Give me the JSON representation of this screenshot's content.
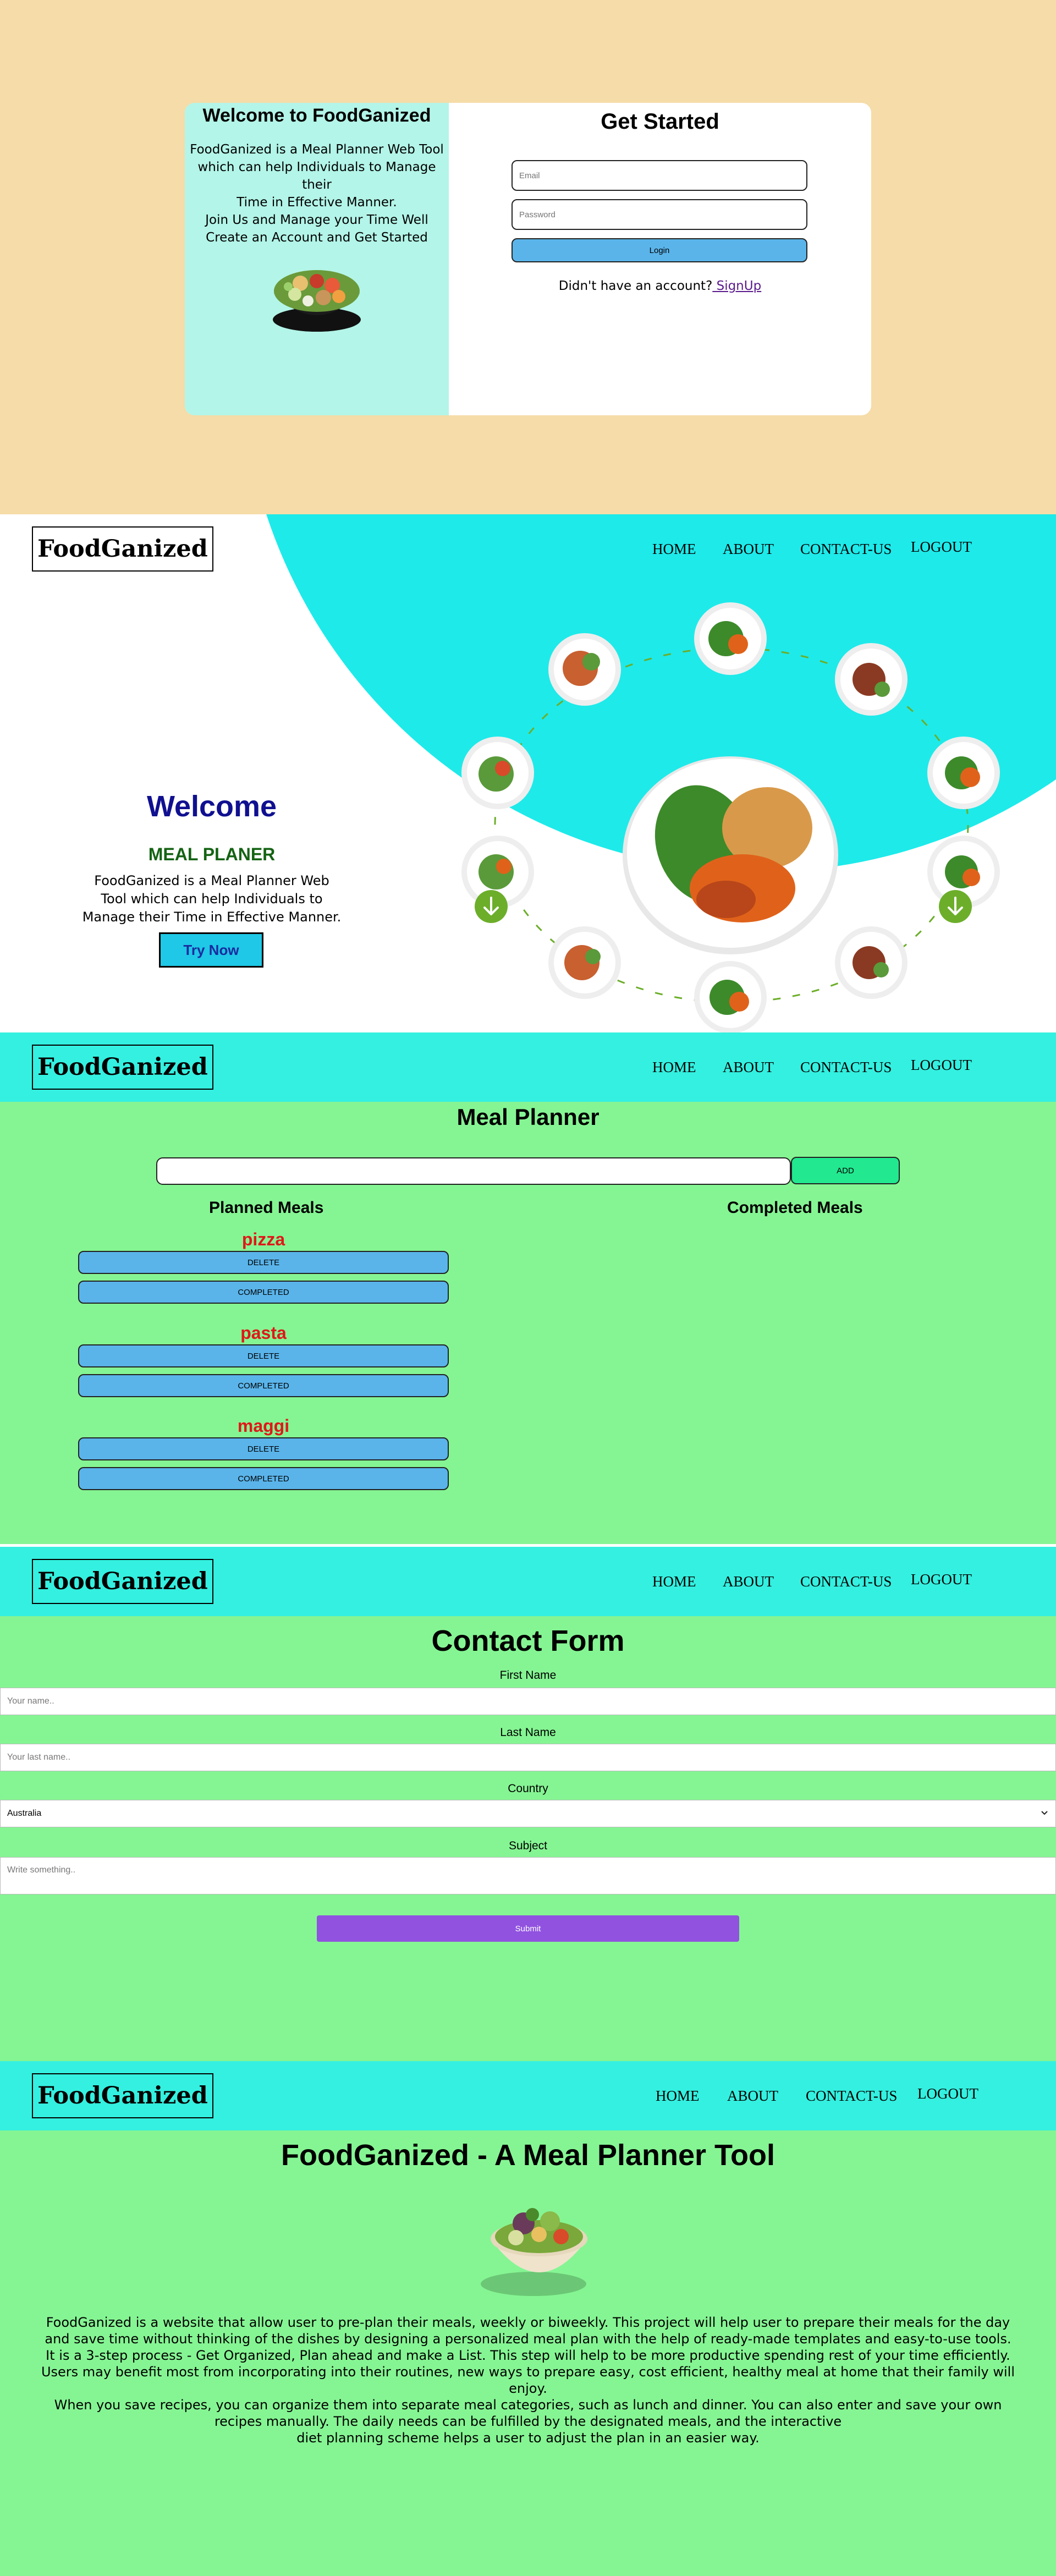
{
  "login": {
    "welcome_title": "Welcome to FoodGanized",
    "intro_lines": [
      "FoodGanized is a Meal Planner Web Tool",
      "which can help Individuals to Manage their",
      "Time in Effective Manner.",
      "Join Us and Manage your Time Well",
      "Create an Account and Get Started"
    ],
    "form_title": "Get Started",
    "email_placeholder": "Email",
    "password_placeholder": "Password",
    "login_label": "Login",
    "no_account_text": "Didn't have an account?",
    "signup_link": " SignUp"
  },
  "nav": {
    "logo": "FoodGanized",
    "items": [
      "HOME",
      "ABOUT",
      "CONTACT-US",
      "LOGOUT"
    ]
  },
  "hero": {
    "welcome": "Welcome",
    "subtitle": "MEAL PLANER",
    "description": "FoodGanized is a Meal Planner Web Tool which can help Individuals to Manage their Time in Effective Manner.",
    "cta_label": "Try Now"
  },
  "planner": {
    "title": "Meal Planner",
    "add_label": "ADD",
    "planned_header": "Planned Meals",
    "completed_header": "Completed Meals",
    "delete_label": "DELETE",
    "completed_label": "COMPLETED",
    "meals": [
      "pizza",
      "pasta",
      "maggi"
    ]
  },
  "contact": {
    "title": "Contact Form",
    "first_name_label": "First Name",
    "first_name_placeholder": "Your name..",
    "last_name_label": "Last Name",
    "last_name_placeholder": "Your last name..",
    "country_label": "Country",
    "country_value": "Australia",
    "subject_label": "Subject",
    "subject_placeholder": "Write something..",
    "submit_label": "Submit"
  },
  "about": {
    "title": "FoodGanized - A Meal Planner Tool",
    "paragraphs": [
      "FoodGanized is a website that allow user to pre-plan their meals, weekly or biweekly. This project will help user to prepare their meals for the day and save time without thinking of the dishes by designing a personalized meal plan with the help of ready-made templates and easy-to-use tools.",
      "It is a 3-step process - Get Organized, Plan ahead and make a List. This step will help to be more productive spending rest of your time efficiently. Users may benefit most from incorporating into their routines, new ways to prepare easy, cost efficient, healthy meal at home that their family will enjoy.",
      "When you save recipes, you can organize them into separate meal categories, such as lunch and dinner. You can also enter and save your own recipes manually. The daily needs can be fulfilled by the designated meals, and the interactive",
      "diet planning scheme helps a user to adjust the plan in an easier way."
    ]
  },
  "colors": {
    "login_bg": "#f5dca8",
    "login_left_bg": "#b3f5e8",
    "hero_accent": "#1eeaea",
    "nav_bg": "#34f0e0",
    "section_bg": "#85f593",
    "button_blue": "#5ab4ea",
    "add_green": "#22e890",
    "meal_red": "#e01818",
    "submit_purple": "#9152e0",
    "welcome_blue": "#101090",
    "subtitle_green": "#146314"
  },
  "icons": [
    "food-salad-image",
    "dish-plate-image",
    "down-arrow-icon",
    "chevron-down-icon",
    "salad-bowl-image"
  ]
}
